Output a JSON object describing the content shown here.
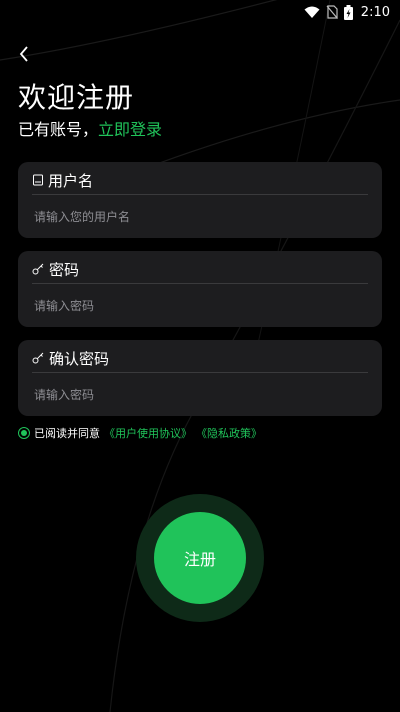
{
  "status_bar": {
    "time": "2:10"
  },
  "page": {
    "title": "欢迎注册",
    "subtitle_prefix": "已有账号，",
    "login_link": "立即登录"
  },
  "form": {
    "username": {
      "label": "用户名",
      "placeholder": "请输入您的用户名",
      "icon": "id-card-icon"
    },
    "password": {
      "label": "密码",
      "placeholder": "请输入密码",
      "icon": "key-icon"
    },
    "confirm_password": {
      "label": "确认密码",
      "placeholder": "请输入密码",
      "icon": "key-icon"
    }
  },
  "agreement": {
    "checked": true,
    "prefix": "已阅读并同意",
    "user_agreement": "《用户使用协议》",
    "privacy_policy": "《隐私政策》"
  },
  "register_button": {
    "label": "注册"
  },
  "colors": {
    "accent": "#20c35a",
    "card": "#1d1d1f",
    "background": "#000000"
  }
}
